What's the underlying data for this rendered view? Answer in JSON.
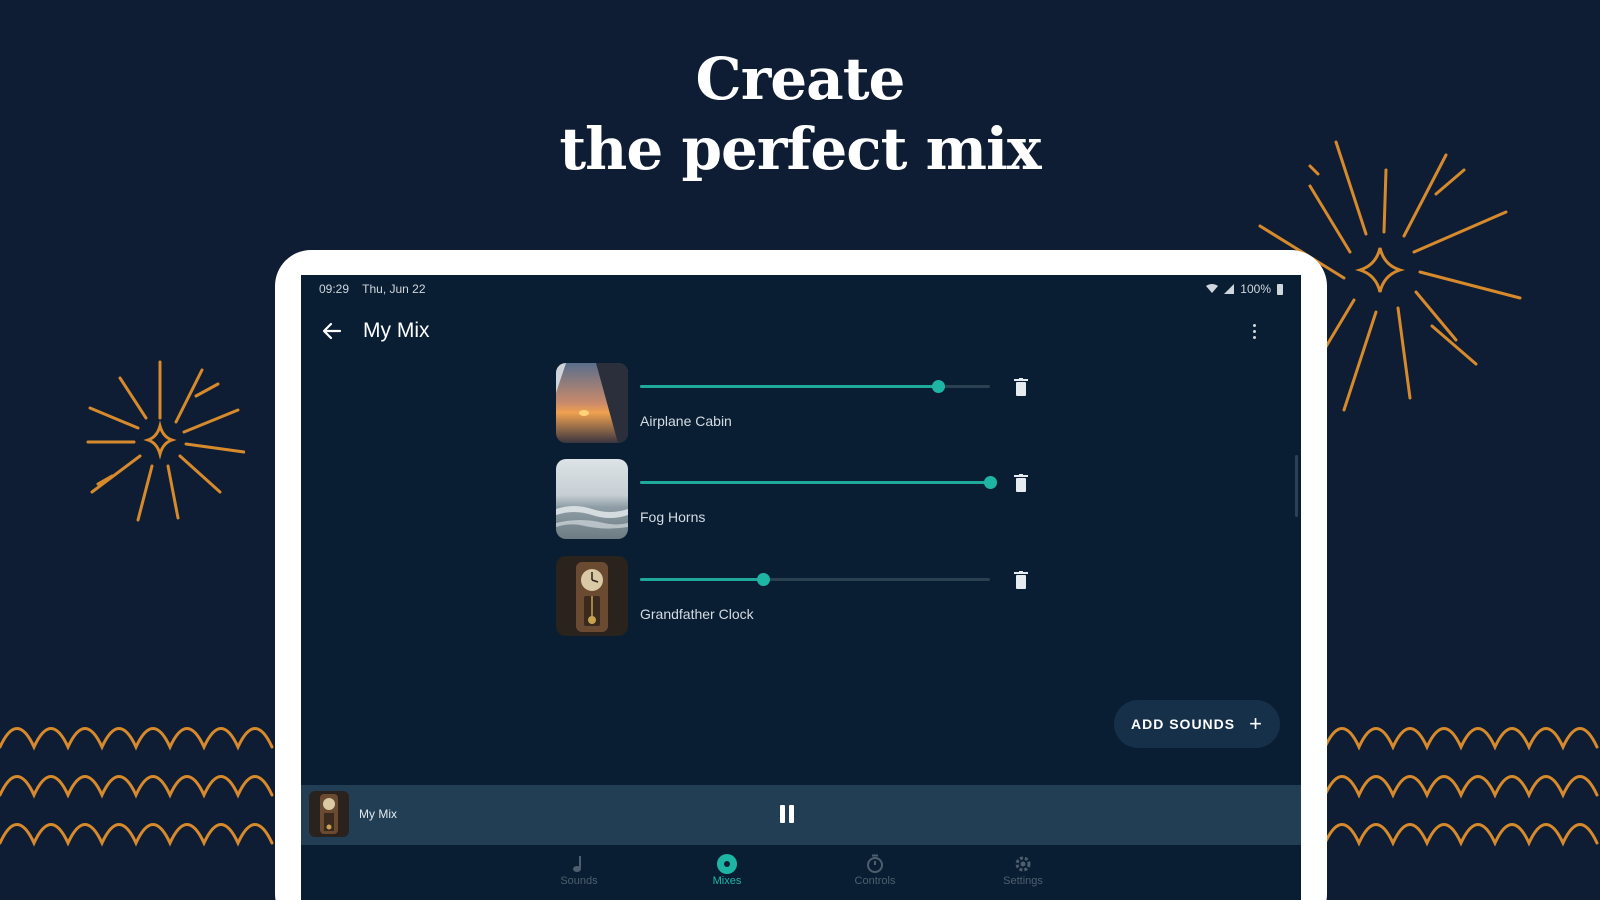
{
  "headline": {
    "line1": "Create",
    "line2": "the perfect mix"
  },
  "colors": {
    "background": "#0e1d33",
    "decoration": "#d78a2c",
    "accent": "#1fb5a5",
    "screen": "#0a1e33"
  },
  "statusbar": {
    "time": "09:29",
    "date": "Thu, Jun 22",
    "battery": "100%"
  },
  "appbar": {
    "title": "My Mix",
    "back_icon": "arrow-left-icon",
    "menu_icon": "more-vert-icon"
  },
  "sounds": [
    {
      "name": "Airplane Cabin",
      "volume": 0.85,
      "image": "airplane-wing-sunset"
    },
    {
      "name": "Fog Horns",
      "volume": 1.0,
      "image": "foggy-sea"
    },
    {
      "name": "Grandfather Clock",
      "volume": 0.35,
      "image": "grandfather-clock"
    }
  ],
  "add_sounds": {
    "label": "ADD SOUNDS",
    "icon": "+"
  },
  "miniplayer": {
    "title": "My Mix",
    "state": "playing"
  },
  "bottomnav": {
    "items": [
      {
        "label": "Sounds",
        "icon": "music-note-icon",
        "active": false
      },
      {
        "label": "Mixes",
        "icon": "mix-disc-icon",
        "active": true
      },
      {
        "label": "Controls",
        "icon": "timer-icon",
        "active": false
      },
      {
        "label": "Settings",
        "icon": "gear-icon",
        "active": false
      }
    ]
  }
}
